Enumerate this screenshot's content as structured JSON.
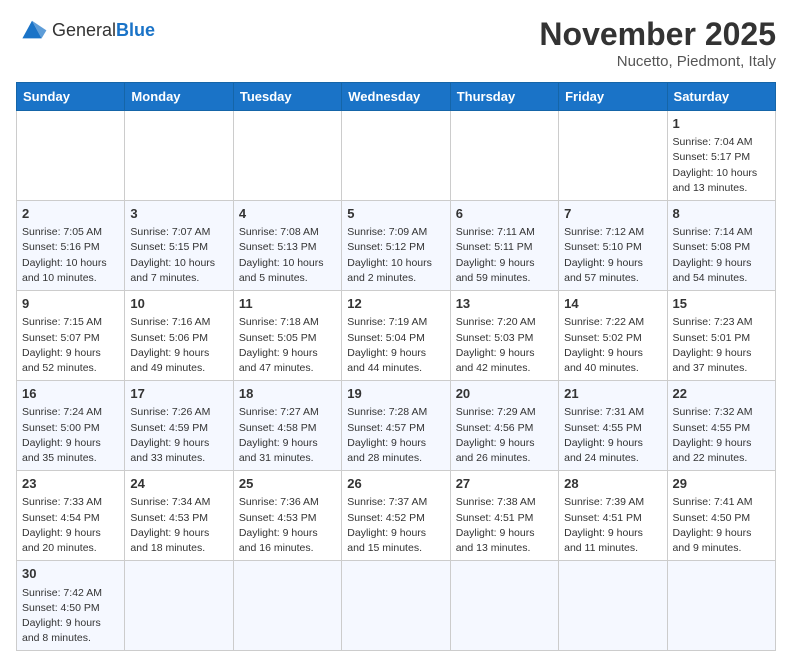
{
  "header": {
    "logo_general": "General",
    "logo_blue": "Blue",
    "month_title": "November 2025",
    "location": "Nucetto, Piedmont, Italy"
  },
  "weekdays": [
    "Sunday",
    "Monday",
    "Tuesday",
    "Wednesday",
    "Thursday",
    "Friday",
    "Saturday"
  ],
  "weeks": [
    [
      {
        "day": "",
        "info": ""
      },
      {
        "day": "",
        "info": ""
      },
      {
        "day": "",
        "info": ""
      },
      {
        "day": "",
        "info": ""
      },
      {
        "day": "",
        "info": ""
      },
      {
        "day": "",
        "info": ""
      },
      {
        "day": "1",
        "info": "Sunrise: 7:04 AM\nSunset: 5:17 PM\nDaylight: 10 hours\nand 13 minutes."
      }
    ],
    [
      {
        "day": "2",
        "info": "Sunrise: 7:05 AM\nSunset: 5:16 PM\nDaylight: 10 hours\nand 10 minutes."
      },
      {
        "day": "3",
        "info": "Sunrise: 7:07 AM\nSunset: 5:15 PM\nDaylight: 10 hours\nand 7 minutes."
      },
      {
        "day": "4",
        "info": "Sunrise: 7:08 AM\nSunset: 5:13 PM\nDaylight: 10 hours\nand 5 minutes."
      },
      {
        "day": "5",
        "info": "Sunrise: 7:09 AM\nSunset: 5:12 PM\nDaylight: 10 hours\nand 2 minutes."
      },
      {
        "day": "6",
        "info": "Sunrise: 7:11 AM\nSunset: 5:11 PM\nDaylight: 9 hours\nand 59 minutes."
      },
      {
        "day": "7",
        "info": "Sunrise: 7:12 AM\nSunset: 5:10 PM\nDaylight: 9 hours\nand 57 minutes."
      },
      {
        "day": "8",
        "info": "Sunrise: 7:14 AM\nSunset: 5:08 PM\nDaylight: 9 hours\nand 54 minutes."
      }
    ],
    [
      {
        "day": "9",
        "info": "Sunrise: 7:15 AM\nSunset: 5:07 PM\nDaylight: 9 hours\nand 52 minutes."
      },
      {
        "day": "10",
        "info": "Sunrise: 7:16 AM\nSunset: 5:06 PM\nDaylight: 9 hours\nand 49 minutes."
      },
      {
        "day": "11",
        "info": "Sunrise: 7:18 AM\nSunset: 5:05 PM\nDaylight: 9 hours\nand 47 minutes."
      },
      {
        "day": "12",
        "info": "Sunrise: 7:19 AM\nSunset: 5:04 PM\nDaylight: 9 hours\nand 44 minutes."
      },
      {
        "day": "13",
        "info": "Sunrise: 7:20 AM\nSunset: 5:03 PM\nDaylight: 9 hours\nand 42 minutes."
      },
      {
        "day": "14",
        "info": "Sunrise: 7:22 AM\nSunset: 5:02 PM\nDaylight: 9 hours\nand 40 minutes."
      },
      {
        "day": "15",
        "info": "Sunrise: 7:23 AM\nSunset: 5:01 PM\nDaylight: 9 hours\nand 37 minutes."
      }
    ],
    [
      {
        "day": "16",
        "info": "Sunrise: 7:24 AM\nSunset: 5:00 PM\nDaylight: 9 hours\nand 35 minutes."
      },
      {
        "day": "17",
        "info": "Sunrise: 7:26 AM\nSunset: 4:59 PM\nDaylight: 9 hours\nand 33 minutes."
      },
      {
        "day": "18",
        "info": "Sunrise: 7:27 AM\nSunset: 4:58 PM\nDaylight: 9 hours\nand 31 minutes."
      },
      {
        "day": "19",
        "info": "Sunrise: 7:28 AM\nSunset: 4:57 PM\nDaylight: 9 hours\nand 28 minutes."
      },
      {
        "day": "20",
        "info": "Sunrise: 7:29 AM\nSunset: 4:56 PM\nDaylight: 9 hours\nand 26 minutes."
      },
      {
        "day": "21",
        "info": "Sunrise: 7:31 AM\nSunset: 4:55 PM\nDaylight: 9 hours\nand 24 minutes."
      },
      {
        "day": "22",
        "info": "Sunrise: 7:32 AM\nSunset: 4:55 PM\nDaylight: 9 hours\nand 22 minutes."
      }
    ],
    [
      {
        "day": "23",
        "info": "Sunrise: 7:33 AM\nSunset: 4:54 PM\nDaylight: 9 hours\nand 20 minutes."
      },
      {
        "day": "24",
        "info": "Sunrise: 7:34 AM\nSunset: 4:53 PM\nDaylight: 9 hours\nand 18 minutes."
      },
      {
        "day": "25",
        "info": "Sunrise: 7:36 AM\nSunset: 4:53 PM\nDaylight: 9 hours\nand 16 minutes."
      },
      {
        "day": "26",
        "info": "Sunrise: 7:37 AM\nSunset: 4:52 PM\nDaylight: 9 hours\nand 15 minutes."
      },
      {
        "day": "27",
        "info": "Sunrise: 7:38 AM\nSunset: 4:51 PM\nDaylight: 9 hours\nand 13 minutes."
      },
      {
        "day": "28",
        "info": "Sunrise: 7:39 AM\nSunset: 4:51 PM\nDaylight: 9 hours\nand 11 minutes."
      },
      {
        "day": "29",
        "info": "Sunrise: 7:41 AM\nSunset: 4:50 PM\nDaylight: 9 hours\nand 9 minutes."
      }
    ],
    [
      {
        "day": "30",
        "info": "Sunrise: 7:42 AM\nSunset: 4:50 PM\nDaylight: 9 hours\nand 8 minutes."
      },
      {
        "day": "",
        "info": ""
      },
      {
        "day": "",
        "info": ""
      },
      {
        "day": "",
        "info": ""
      },
      {
        "day": "",
        "info": ""
      },
      {
        "day": "",
        "info": ""
      },
      {
        "day": "",
        "info": ""
      }
    ]
  ]
}
